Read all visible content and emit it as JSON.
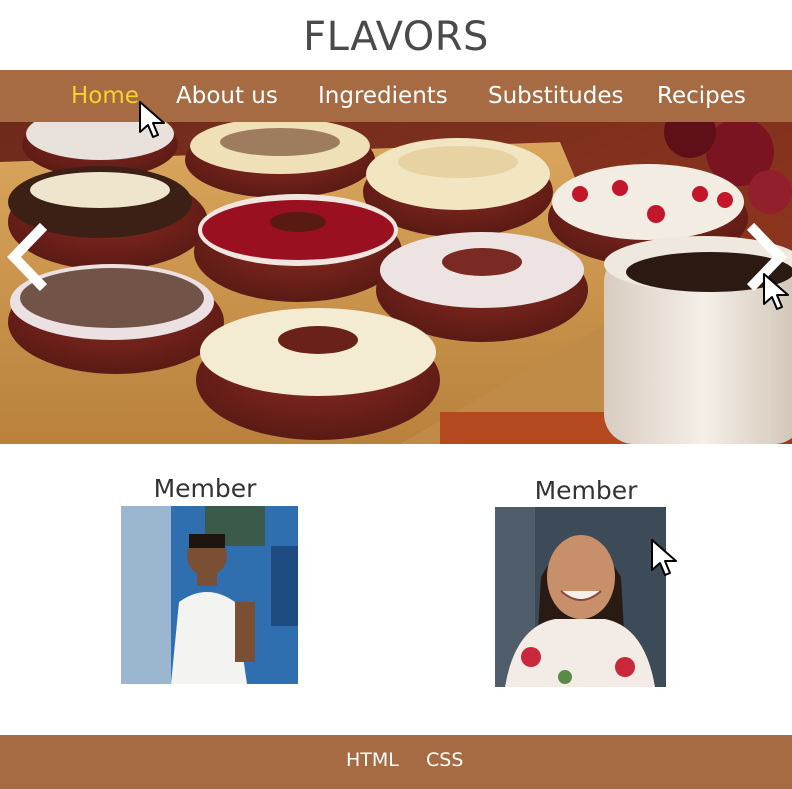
{
  "site": {
    "title": "FLAVORS"
  },
  "nav": {
    "items": [
      {
        "label": "Home",
        "active": true
      },
      {
        "label": "About us",
        "active": false
      },
      {
        "label": "Ingredients",
        "active": false
      },
      {
        "label": "Substitudes",
        "active": false
      },
      {
        "label": "Recipes",
        "active": false
      }
    ]
  },
  "carousel": {
    "prev_icon": "chevron-left-icon",
    "next_icon": "chevron-right-icon"
  },
  "members": [
    {
      "label": "Member"
    },
    {
      "label": "Member"
    }
  ],
  "footer": {
    "links": [
      "HTML",
      "CSS"
    ]
  },
  "colors": {
    "brand": "#a66b43",
    "active_nav": "#f6d32b",
    "text": "#4a4a4a"
  }
}
